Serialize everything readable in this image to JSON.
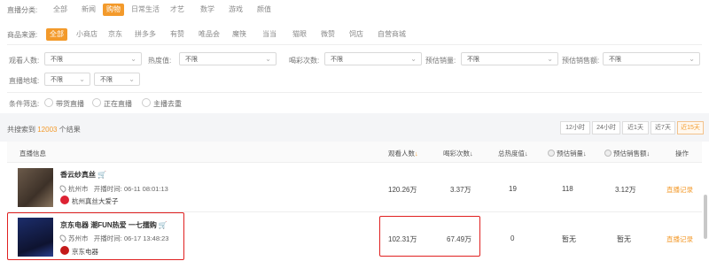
{
  "filters": {
    "category_label": "直播分类:",
    "categories": [
      "全部",
      "新闻",
      "购物",
      "日常生活",
      "才艺",
      "数学",
      "游戏",
      "颜值"
    ],
    "source_label": "商品来源:",
    "sources": [
      "全部",
      "小商店",
      "京东",
      "拼多多",
      "有赞",
      "唯品会",
      "魔筷",
      "当当",
      "猫眼",
      "微赞",
      "饲店",
      "自营商城"
    ],
    "viewers_label": "观看人数:",
    "heat_label": "热度值:",
    "likes_label": "喝彩次数:",
    "est_sales_label": "预估销量:",
    "est_amount_label": "预估销售额:",
    "region_label": "直播地域:",
    "unlimited": "不限",
    "conditions_label": "条件筛选:",
    "conditions": [
      "带货直播",
      "正在直播",
      "主播去重"
    ]
  },
  "results": {
    "prefix": "共搜索到",
    "count": "12003",
    "suffix": "个结果",
    "time_ranges": [
      "12小时",
      "24小时",
      "近1天",
      "近7天",
      "近15天"
    ],
    "active_range": "近15天"
  },
  "table": {
    "headers": {
      "info": "直播信息",
      "viewers": "观看人数",
      "likes": "喝彩次数",
      "heat": "总热度值",
      "est_sales": "预估销量",
      "est_amount": "预估销售额",
      "action": "操作"
    },
    "rows": [
      {
        "title": "香云纱真丝",
        "city": "杭州市",
        "start_label": "开播时间:",
        "start_time": "06-11 08:01:13",
        "anchor": "杭州真丝大爱子",
        "viewers": "120.26万",
        "likes": "3.37万",
        "heat": "19",
        "est_sales": "118",
        "est_amount": "3.12万",
        "action": "直播记录"
      },
      {
        "title": "京东电器 潮FUN热爱 一七擂购",
        "city": "苏州市",
        "start_label": "开播时间:",
        "start_time": "06-17 13:48:23",
        "anchor": "京东电器",
        "viewers": "102.31万",
        "likes": "67.49万",
        "heat": "0",
        "est_sales": "暂无",
        "est_amount": "暂无",
        "action": "直播记录"
      }
    ]
  },
  "colors": {
    "accent": "#f39a2b",
    "highlight": "#e02020"
  }
}
